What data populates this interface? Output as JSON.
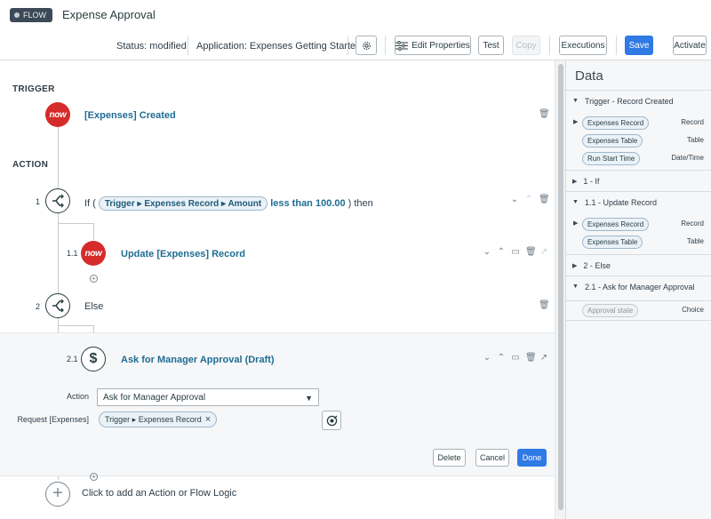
{
  "header": {
    "badge": "FLOW",
    "title": "Expense Approval",
    "status": "Status: modified",
    "application": "Application: Expenses Getting Started",
    "buttons": {
      "edit_properties": "Edit Properties",
      "test": "Test",
      "copy": "Copy",
      "executions": "Executions",
      "save": "Save",
      "activate": "Activate"
    }
  },
  "canvas": {
    "trigger_label": "TRIGGER",
    "action_label": "ACTION",
    "trigger_icon_text": "now",
    "trigger_title": "[Expenses] Created",
    "step1": {
      "num": "1",
      "prefix": "If (",
      "condition_pill": "Trigger ▸ Expenses Record ▸ Amount",
      "operator": "less than 100.00",
      "suffix": ") then"
    },
    "step1_1": {
      "num": "1.1",
      "icon_text": "now",
      "title": "Update [Expenses] Record"
    },
    "step2": {
      "num": "2",
      "label": "Else"
    },
    "step2_1": {
      "num": "2.1",
      "icon_text": "$",
      "title": "Ask for Manager Approval (Draft)",
      "form": {
        "action_label": "Action",
        "action_value": "Ask for Manager Approval",
        "request_label": "Request [Expenses]",
        "request_pill": "Trigger ▸ Expenses Record",
        "request_remove": "×",
        "delete": "Delete",
        "cancel": "Cancel",
        "done": "Done"
      }
    },
    "add_prompt": "Click to add an Action or Flow Logic"
  },
  "data_panel": {
    "title": "Data",
    "sections": [
      {
        "label": "Trigger - Record Created",
        "expanded": true,
        "rows": [
          {
            "pill": "Expenses Record",
            "type": "Record",
            "expandable": true
          },
          {
            "pill": "Expenses Table",
            "type": "Table",
            "expandable": false
          },
          {
            "pill": "Run Start Time",
            "type": "Date/Time",
            "expandable": false
          }
        ]
      },
      {
        "label": "1 - If",
        "expanded": false,
        "rows": []
      },
      {
        "label": "1.1 - Update Record",
        "expanded": true,
        "rows": [
          {
            "pill": "Expenses Record",
            "type": "Record",
            "expandable": true
          },
          {
            "pill": "Expenses Table",
            "type": "Table",
            "expandable": false
          }
        ]
      },
      {
        "label": "2 - Else",
        "expanded": false,
        "rows": []
      },
      {
        "label": "2.1 - Ask for Manager Approval",
        "expanded": true,
        "rows": [
          {
            "pill": "Approval state",
            "type": "Choice",
            "expandable": false
          }
        ]
      }
    ]
  },
  "colors": {
    "primary": "#2f7ae5",
    "now_red": "#d52b2b",
    "link_teal": "#1f6d93"
  }
}
